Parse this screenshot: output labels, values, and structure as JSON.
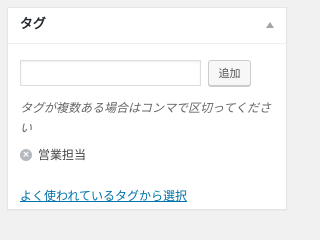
{
  "box": {
    "title": "タグ",
    "toggle_icon": "arrow-up-icon"
  },
  "tag_input": {
    "value": "",
    "placeholder": ""
  },
  "add_button": {
    "label": "追加"
  },
  "help_text": "タグが複数ある場合はコンマで区切ってください",
  "tags": [
    {
      "label": "営業担当",
      "remove_icon": "remove-circle-icon"
    }
  ],
  "tag_cloud_link": "よく使われているタグから選択",
  "colors": {
    "link": "#0073aa",
    "remove_icon": "#b4b9be"
  }
}
